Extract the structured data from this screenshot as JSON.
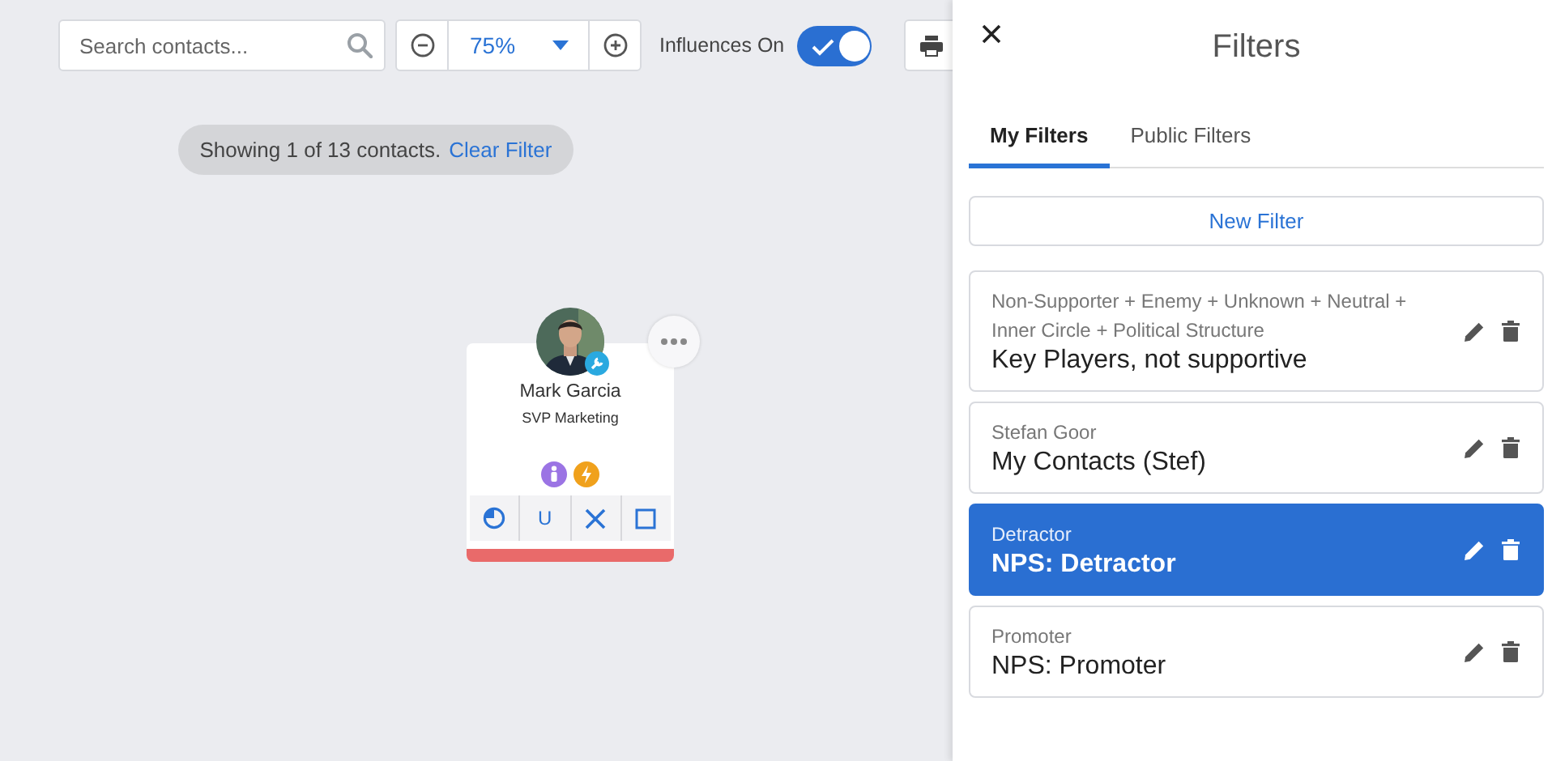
{
  "toolbar": {
    "search": {
      "placeholder": "Search contacts..."
    },
    "zoom": "75%",
    "influences": {
      "label": "Influences On",
      "on": true
    }
  },
  "status": {
    "text": "Showing 1 of 13 contacts.",
    "link": "Clear Filter"
  },
  "contact": {
    "name": "Mark Garcia",
    "title": "SVP Marketing",
    "badges": [
      {
        "kind": "person",
        "color": "#9b74e4"
      },
      {
        "kind": "bolt",
        "color": "#f0a11c"
      }
    ],
    "actions": [
      {
        "kind": "circle"
      },
      {
        "kind": "text",
        "label": "U"
      },
      {
        "kind": "cross"
      },
      {
        "kind": "square"
      }
    ]
  },
  "panel": {
    "title": "Filters",
    "tabs": [
      {
        "label": "My Filters",
        "selected": true
      },
      {
        "label": "Public Filters",
        "selected": false
      }
    ],
    "new_filter": "New Filter",
    "filters": [
      {
        "criteria": "Non-Supporter + Enemy + Unknown + Neutral + Inner Circle + Political Structure",
        "name": "Key Players, not supportive",
        "selected": false
      },
      {
        "criteria": "Stefan Goor",
        "name": "My Contacts (Stef)",
        "selected": false
      },
      {
        "criteria": "Detractor",
        "name": "NPS: Detractor",
        "selected": true
      },
      {
        "criteria": "Promoter",
        "name": "NPS: Promoter",
        "selected": false
      }
    ]
  }
}
